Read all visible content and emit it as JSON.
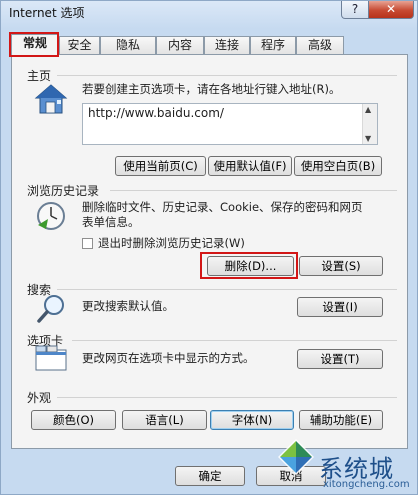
{
  "window": {
    "title": "Internet 选项",
    "help_label": "?",
    "close_label": "✕"
  },
  "tabs": [
    {
      "label": "常规"
    },
    {
      "label": "安全"
    },
    {
      "label": "隐私"
    },
    {
      "label": "内容"
    },
    {
      "label": "连接"
    },
    {
      "label": "程序"
    },
    {
      "label": "高级"
    }
  ],
  "home": {
    "title": "主页",
    "description": "若要创建主页选项卡，请在各地址行键入地址(R)。",
    "url": "http://www.baidu.com/",
    "buttons": {
      "use_current": "使用当前页(C)",
      "use_default": "使用默认值(F)",
      "use_blank": "使用空白页(B)"
    }
  },
  "history": {
    "title": "浏览历史记录",
    "description_line1": "删除临时文件、历史记录、Cookie、保存的密码和网页",
    "description_line2": "表单信息。",
    "checkbox_label": "退出时删除浏览历史记录(W)",
    "delete_label": "删除(D)...",
    "settings_label": "设置(S)"
  },
  "search": {
    "title": "搜索",
    "description": "更改搜索默认值。",
    "settings_label": "设置(I)"
  },
  "tabsection": {
    "title": "选项卡",
    "description": "更改网页在选项卡中显示的方式。",
    "settings_label": "设置(T)"
  },
  "appearance": {
    "title": "外观",
    "colors_label": "颜色(O)",
    "languages_label": "语言(L)",
    "fonts_label": "字体(N)",
    "accessibility_label": "辅助功能(E)"
  },
  "footer": {
    "ok_label": "确定",
    "cancel_label": "取消"
  },
  "watermark": {
    "text": "系统城",
    "url": "xitongcheng.com"
  }
}
